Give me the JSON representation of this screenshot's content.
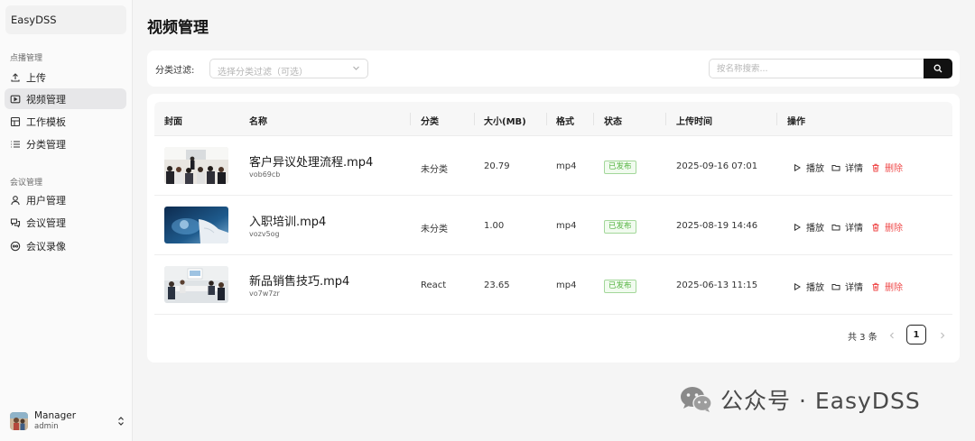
{
  "sidebar": {
    "brand": "EasyDSS",
    "groups": [
      {
        "title": "点播管理",
        "items": [
          {
            "label": "上传",
            "icon": "upload-icon"
          },
          {
            "label": "视频管理",
            "icon": "video-icon",
            "active": true
          },
          {
            "label": "工作模板",
            "icon": "template-icon"
          },
          {
            "label": "分类管理",
            "icon": "list-icon"
          }
        ]
      },
      {
        "title": "会议管理",
        "items": [
          {
            "label": "用户管理",
            "icon": "user-icon"
          },
          {
            "label": "会议管理",
            "icon": "meeting-icon"
          },
          {
            "label": "会议录像",
            "icon": "recording-icon"
          }
        ]
      }
    ],
    "user": {
      "name": "Manager",
      "role": "admin"
    }
  },
  "main": {
    "title": "视频管理",
    "filter": {
      "label": "分类过滤:",
      "select_placeholder": "选择分类过滤（可选）",
      "search_placeholder": "按名称搜索..."
    },
    "table": {
      "headers": [
        "封面",
        "名称",
        "分类",
        "大小(MB)",
        "格式",
        "状态",
        "上传时间",
        "操作"
      ],
      "rows": [
        {
          "name": "客户异议处理流程.mp4",
          "id": "vob69cb",
          "category": "未分类",
          "size": "20.79",
          "format": "mp4",
          "status": "已发布",
          "uploaded": "2025-09-16 07:01"
        },
        {
          "name": "入职培训.mp4",
          "id": "vozv5og",
          "category": "未分类",
          "size": "1.00",
          "format": "mp4",
          "status": "已发布",
          "uploaded": "2025-08-19 14:46"
        },
        {
          "name": "新品销售技巧.mp4",
          "id": "vo7w7zr",
          "category": "React",
          "size": "23.65",
          "format": "mp4",
          "status": "已发布",
          "uploaded": "2025-06-13 11:15"
        }
      ],
      "actions": {
        "play": "播放",
        "detail": "详情",
        "delete": "删除"
      }
    },
    "pagination": {
      "total": "共 3 条",
      "current": "1"
    }
  },
  "watermark": "公众号 · EasyDSS",
  "colors": {
    "accent": "#111111",
    "status_green": "#52b33f",
    "delete_red": "#ef4b4b",
    "active_nav": "#e7e7e9"
  }
}
